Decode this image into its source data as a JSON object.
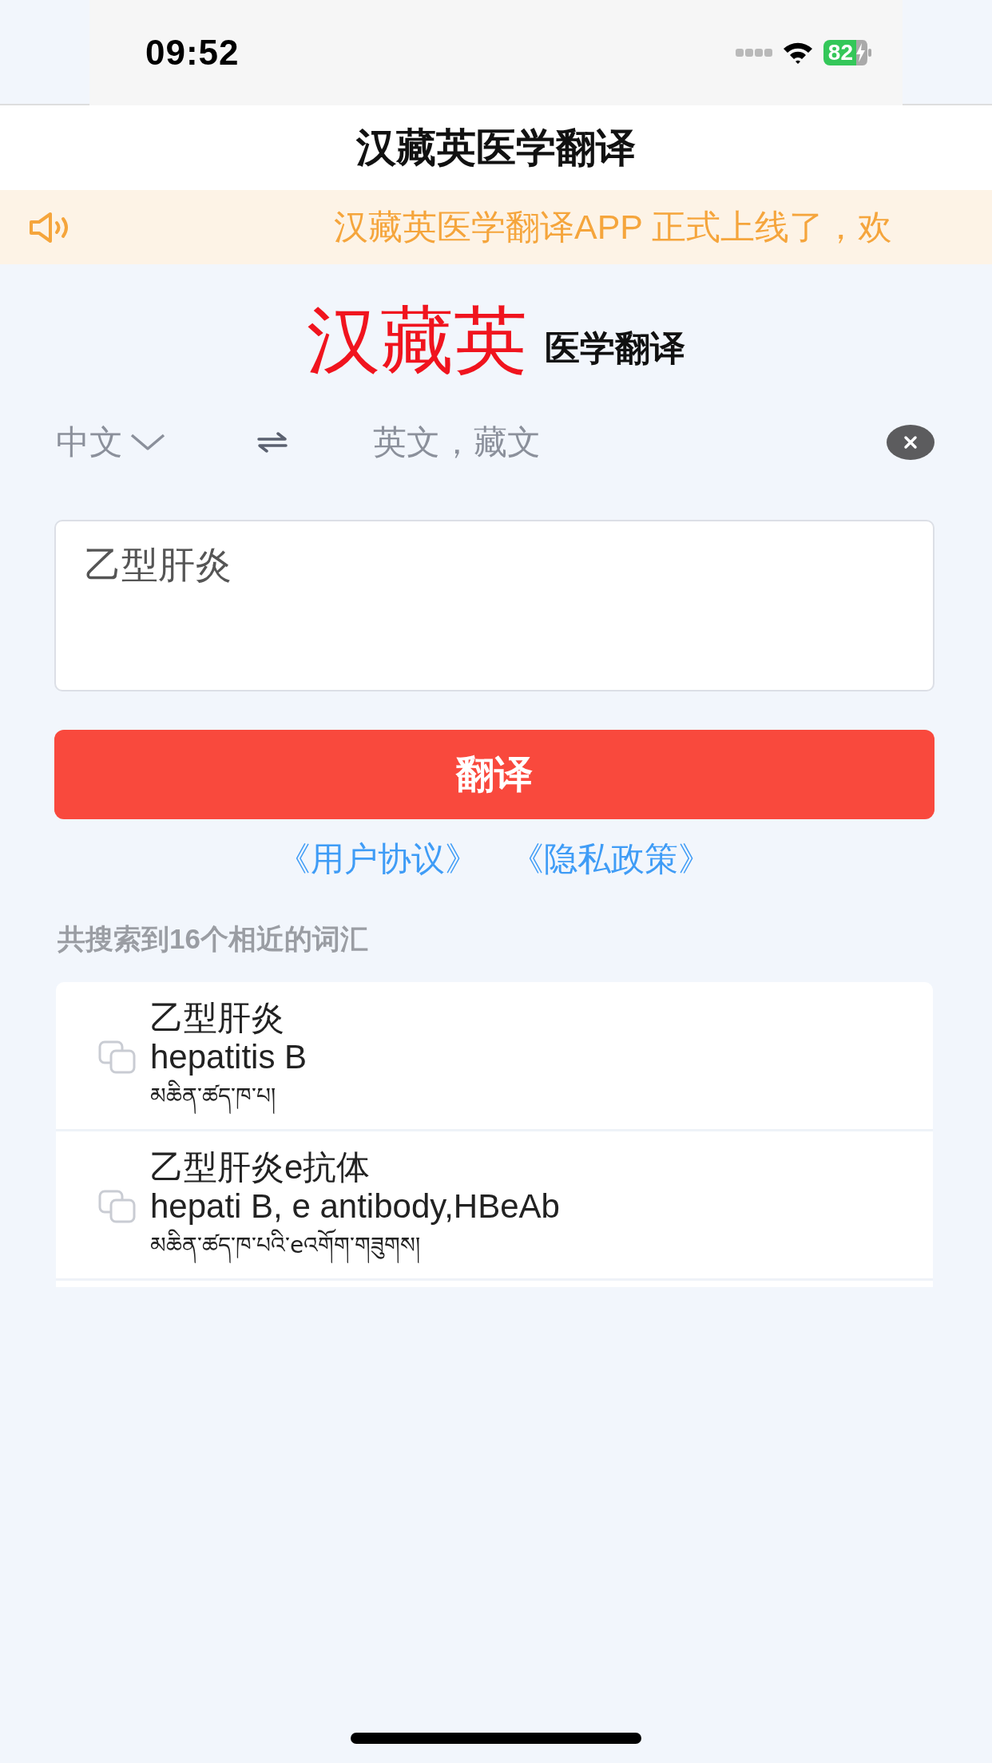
{
  "status_bar": {
    "time": "09:52",
    "battery": "82"
  },
  "nav_bar": {
    "title": "汉藏英医学翻译"
  },
  "notice": {
    "text": "汉藏英医学翻译APP 正式上线了，欢"
  },
  "logo": {
    "main": "汉藏英",
    "sub": "医学翻译"
  },
  "language_bar": {
    "source": "中文",
    "target": "英文，藏文"
  },
  "input": {
    "value": "乙型肝炎"
  },
  "translate_button": {
    "label": "翻译"
  },
  "links": [
    "《用户协议》",
    "《隐私政策》"
  ],
  "results": {
    "summary": "共搜索到16个相近的词汇",
    "items": [
      {
        "chinese": "乙型肝炎",
        "english": "hepatitis B",
        "tibetan": "མཆིན་ཚད་ཁ་པ།"
      },
      {
        "chinese": "乙型肝炎e抗体",
        "english": "hepati B, e antibody,HBeAb",
        "tibetan": "མཆིན་ཚད་ཁ་པའི་eའགོག་གཟུགས།"
      }
    ]
  }
}
